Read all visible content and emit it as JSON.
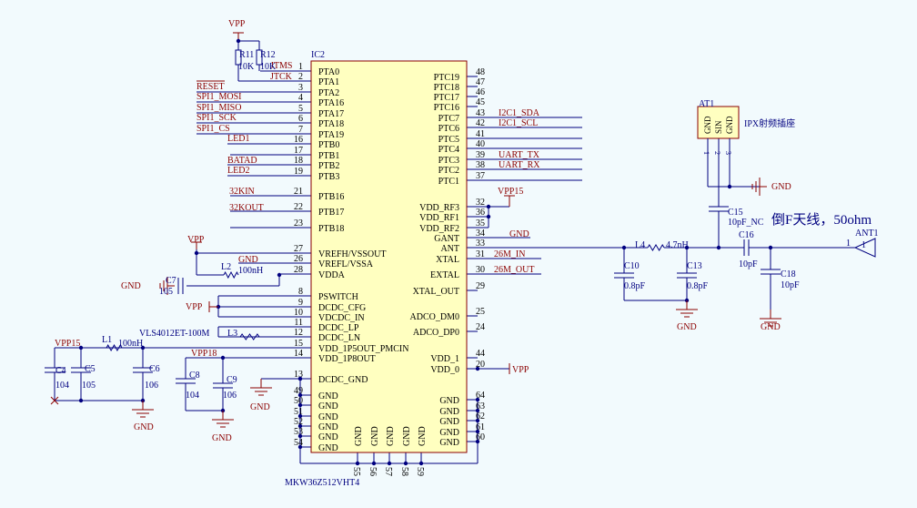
{
  "colors": {
    "wire": "#000080",
    "power": "#8b0000",
    "chip_fill": "#ffffc0",
    "chip_border": "#8b0000",
    "background": "#f2fafd"
  },
  "chip": {
    "designator": "IC2",
    "part": "MKW36Z512VHT4",
    "left_pins": [
      {
        "name": "PTA0",
        "num": "1"
      },
      {
        "name": "PTA1",
        "num": "2"
      },
      {
        "name": "PTA2",
        "num": "3"
      },
      {
        "name": "PTA16",
        "num": "4"
      },
      {
        "name": "PTA17",
        "num": "5"
      },
      {
        "name": "PTA18",
        "num": "6"
      },
      {
        "name": "PTA19",
        "num": "7"
      },
      {
        "name": "PTB0",
        "num": "16"
      },
      {
        "name": "PTB1",
        "num": "17"
      },
      {
        "name": "PTB2",
        "num": "18"
      },
      {
        "name": "PTB3",
        "num": "19"
      },
      {
        "name": "PTB16",
        "num": "21"
      },
      {
        "name": "PTB17",
        "num": "22"
      },
      {
        "name": "PTB18",
        "num": "23"
      },
      {
        "name": "VREFH/VSSOUT",
        "num": "27"
      },
      {
        "name": "VREFL/VSSA",
        "num": "26"
      },
      {
        "name": "VDDA",
        "num": "28"
      },
      {
        "name": "PSWITCH",
        "num": "8"
      },
      {
        "name": "DCDC_CFG",
        "num": "9"
      },
      {
        "name": "VDCDC_IN",
        "num": "10"
      },
      {
        "name": "DCDC_LP",
        "num": "11"
      },
      {
        "name": "DCDC_LN",
        "num": "12"
      },
      {
        "name": "VDD_1P5OUT_PMCIN",
        "num": "15"
      },
      {
        "name": "VDD_1P8OUT",
        "num": "14"
      },
      {
        "name": "DCDC_GND",
        "num": "13"
      },
      {
        "name": "GND",
        "num": "49"
      },
      {
        "name": "GND",
        "num": "50"
      },
      {
        "name": "GND",
        "num": "51"
      },
      {
        "name": "GND",
        "num": "52"
      },
      {
        "name": "GND",
        "num": "53"
      },
      {
        "name": "GND",
        "num": "54"
      }
    ],
    "right_pins": [
      {
        "name": "PTC19",
        "num": "48"
      },
      {
        "name": "PTC18",
        "num": "47"
      },
      {
        "name": "PTC17",
        "num": "46"
      },
      {
        "name": "PTC16",
        "num": "45"
      },
      {
        "name": "PTC7",
        "num": "43"
      },
      {
        "name": "PTC6",
        "num": "42"
      },
      {
        "name": "PTC5",
        "num": "41"
      },
      {
        "name": "PTC4",
        "num": "40"
      },
      {
        "name": "PTC3",
        "num": "39"
      },
      {
        "name": "PTC2",
        "num": "38"
      },
      {
        "name": "PTC1",
        "num": "37"
      },
      {
        "name": "VDD_RF3",
        "num": "32"
      },
      {
        "name": "VDD_RF1",
        "num": "36"
      },
      {
        "name": "VDD_RF2",
        "num": "35"
      },
      {
        "name": "GANT",
        "num": "34"
      },
      {
        "name": "ANT",
        "num": "33"
      },
      {
        "name": "XTAL",
        "num": "31"
      },
      {
        "name": "EXTAL",
        "num": "30"
      },
      {
        "name": "XTAL_OUT",
        "num": "29"
      },
      {
        "name": "ADCO_DM0",
        "num": "25"
      },
      {
        "name": "ADCO_DP0",
        "num": "24"
      },
      {
        "name": "VDD_1",
        "num": "44"
      },
      {
        "name": "VDD_0",
        "num": "20"
      },
      {
        "name": "GND",
        "num": "64"
      },
      {
        "name": "GND",
        "num": "63"
      },
      {
        "name": "GND",
        "num": "62"
      },
      {
        "name": "GND",
        "num": "61"
      },
      {
        "name": "GND",
        "num": "60"
      }
    ],
    "bottom_pins": [
      {
        "name": "GND",
        "num": "55"
      },
      {
        "name": "GND",
        "num": "56"
      },
      {
        "name": "GND",
        "num": "57"
      },
      {
        "name": "GND",
        "num": "58"
      },
      {
        "name": "GND",
        "num": "59"
      }
    ]
  },
  "net_labels": [
    "RESET",
    "SPI1_MOSI",
    "SPI1_MISO",
    "SPI1_SCK",
    "SPI1_CS",
    "LED1",
    "BATAD",
    "LED2",
    "32KIN",
    "32KOUT",
    "JTMS",
    "JTCK",
    "I2C1_SDA",
    "I2C1_SCL",
    "UART_TX",
    "UART_RX",
    "26M_IN",
    "26M_OUT"
  ],
  "power_labels": [
    "VPP",
    "VPP15",
    "GND",
    "VPP",
    "GND",
    "GND",
    "VPP",
    "VPP15",
    "VPP18",
    "VPP",
    "GND",
    "GND",
    "GND",
    "GND",
    "GND",
    "GND"
  ],
  "component_labels": [
    "R11",
    "R12",
    "10K",
    "10K",
    "L2",
    "100nH",
    "C7",
    "105",
    "L1",
    "100nH",
    "VLS4012ET-100M",
    "L3",
    "C4",
    "104",
    "C5",
    "105",
    "C6",
    "106",
    "C8",
    "104",
    "C9",
    "106",
    "L4",
    "4.7nH",
    "C10",
    "0.8pF",
    "C13",
    "0.8pF",
    "C15",
    "10pF_NC",
    "C16",
    "10pF",
    "C18",
    "10pF",
    "AT1",
    "IPX射频插座",
    "ANT1",
    "1",
    "1",
    "2",
    "3",
    "1"
  ],
  "connector_pins": [
    "GND",
    "SIN",
    "GND"
  ],
  "annotation": "倒F天线，50ohm"
}
